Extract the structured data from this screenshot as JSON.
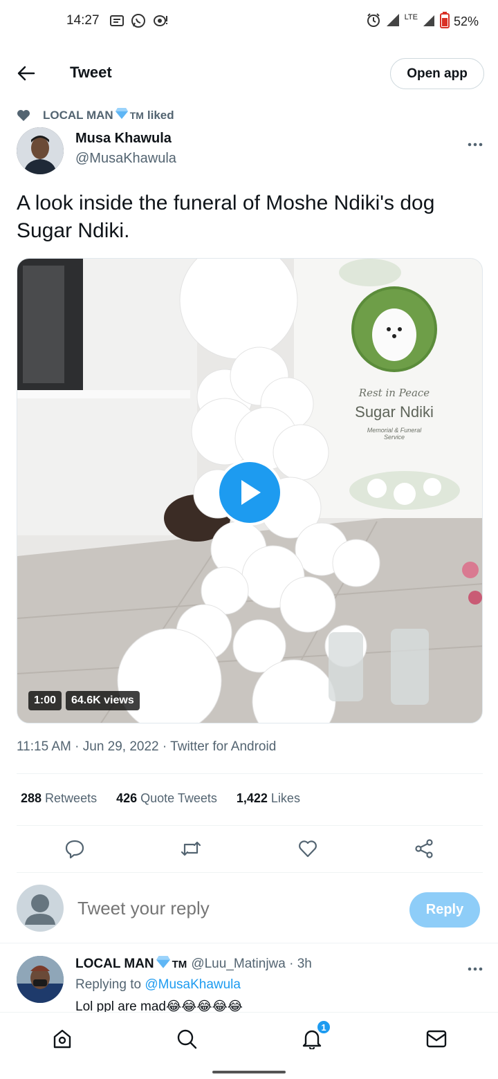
{
  "status_bar": {
    "time": "14:27",
    "battery": "52%",
    "network": "LTE",
    "icons": [
      "message-icon",
      "whatsapp-icon",
      "chat-alert-icon",
      "alarm-icon",
      "signal-icon",
      "battery-icon"
    ]
  },
  "header": {
    "title": "Tweet",
    "open_app_label": "Open app"
  },
  "social_context": {
    "user": "LOCAL MAN",
    "tm": "TM",
    "action": "liked"
  },
  "tweet": {
    "author_name": "Musa Khawula",
    "author_handle": "@MusaKhawula",
    "text": "A look inside the funeral of Moshe Ndiki's dog Sugar Ndiki.",
    "media": {
      "duration": "1:00",
      "views": "64.6K views",
      "sign_line1": "Rest in Peace",
      "sign_line2": "Sugar Ndiki",
      "sign_line3": "Memorial & Funeral",
      "sign_line4": "Service"
    },
    "timestamp": "11:15 AM · Jun 29, 2022 · Twitter for Android",
    "stats": {
      "retweets_count": "288",
      "retweets_label": "Retweets",
      "quotes_count": "426",
      "quotes_label": "Quote Tweets",
      "likes_count": "1,422",
      "likes_label": "Likes"
    }
  },
  "composer": {
    "placeholder": "Tweet your reply",
    "reply_label": "Reply"
  },
  "reply": {
    "name": "LOCAL MAN",
    "tm": "TM",
    "handle_time": "@Luu_Matinjwa · 3h",
    "replying_prefix": "Replying to",
    "replying_to": "@MusaKhawula",
    "text": "Lol ppl are mad😂😂😂😂😂"
  },
  "bottom_nav": {
    "notification_count": "1"
  },
  "colors": {
    "accent": "#1d9bf0",
    "text_primary": "#0f1419",
    "text_secondary": "#536471",
    "reply_disabled": "#8ecdf8"
  }
}
